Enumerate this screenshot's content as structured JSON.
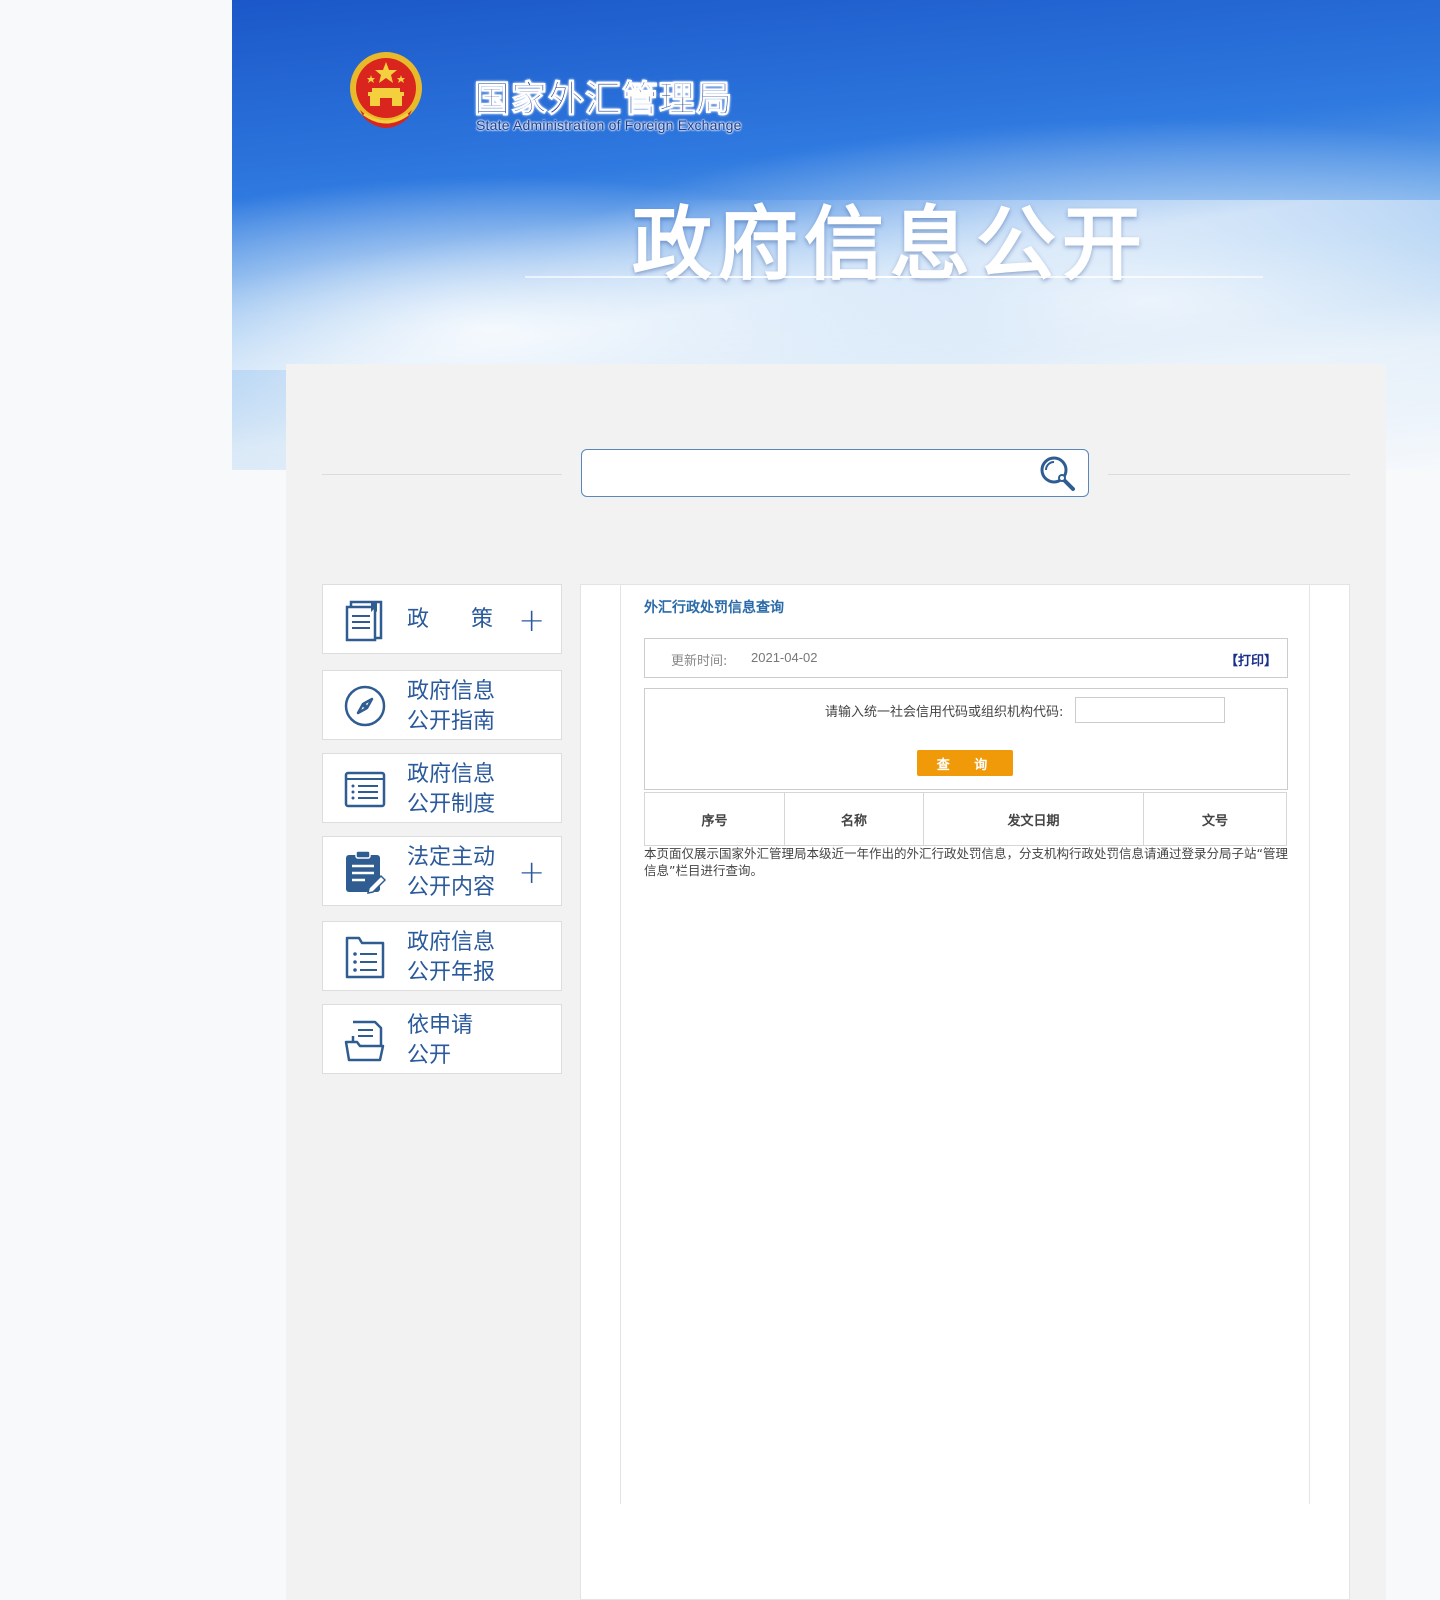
{
  "header": {
    "org_name_cn": "国家外汇管理局",
    "org_name_en": "State Administration of Foreign Exchange",
    "banner_title": "政府信息公开",
    "emblem_icon": "national-emblem-icon",
    "accent_color": "#1b57c8"
  },
  "search": {
    "value": "",
    "placeholder": "",
    "icon": "search-icon"
  },
  "sidebar": {
    "items": [
      {
        "label": "政策",
        "icon": "policy-book-icon",
        "expandable": true,
        "plus": "+"
      },
      {
        "label": "政府信息公开指南",
        "line1": "政府信息",
        "line2": "公开指南",
        "icon": "compass-icon",
        "expandable": false
      },
      {
        "label": "政府信息公开制度",
        "line1": "政府信息",
        "line2": "公开制度",
        "icon": "list-document-icon",
        "expandable": false
      },
      {
        "label": "法定主动公开内容",
        "line1": "法定主动",
        "line2": "公开内容",
        "icon": "clipboard-edit-icon",
        "expandable": true,
        "plus": "+"
      },
      {
        "label": "政府信息公开年报",
        "line1": "政府信息",
        "line2": "公开年报",
        "icon": "report-list-icon",
        "expandable": false
      },
      {
        "label": "依申请公开",
        "line1": "依申请",
        "line2": "公开",
        "icon": "application-form-icon",
        "expandable": false
      }
    ]
  },
  "content": {
    "section_title": "外汇行政处罚信息查询",
    "update_label": "更新时间:",
    "update_date": "2021-04-02",
    "print_label": "【打印】",
    "query_label": "请输入统一社会信用代码或组织机构代码:",
    "query_value": "",
    "query_button": "查 询",
    "query_button_color": "#f09a0a",
    "table_headers": [
      "序号",
      "名称",
      "发文日期",
      "文号"
    ],
    "table_rows": [],
    "note": "本页面仅展示国家外汇管理局本级近一年作出的外汇行政处罚信息，分支机构行政处罚信息请通过登录分局子站“管理信息”栏目进行查询。"
  }
}
